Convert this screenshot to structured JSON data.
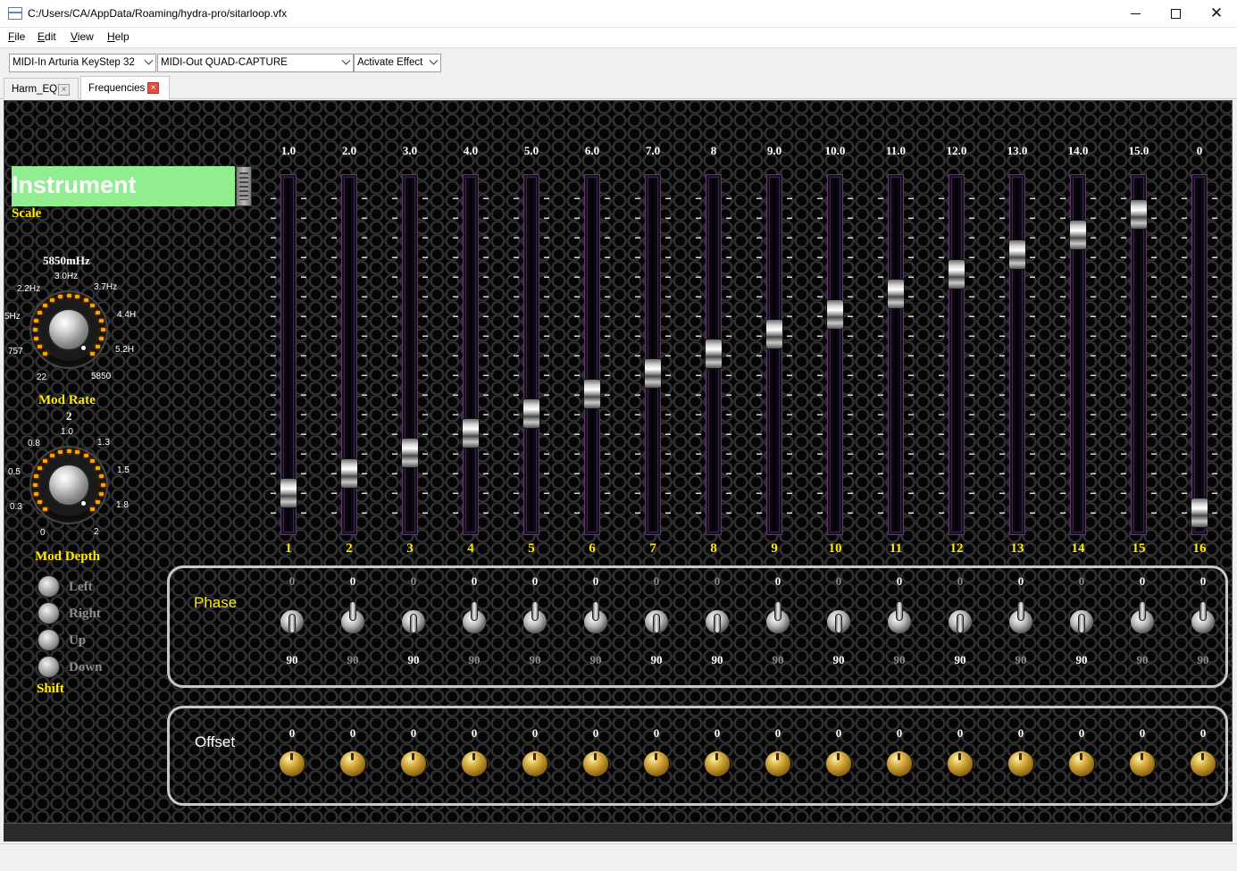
{
  "window": {
    "title": "C:/Users/CA/AppData/Roaming/hydra-pro/sitarloop.vfx",
    "minimize_glyph": "",
    "close_glyph": "✕"
  },
  "menu": [
    "File",
    "Edit",
    "View",
    "Help"
  ],
  "toolbar": {
    "midi_in": "MIDI-In Arturia KeyStep 32",
    "midi_out": "MIDI-Out QUAD-CAPTURE",
    "activate": "Activate Effect"
  },
  "tabs": [
    {
      "label": "Harm_EQ",
      "active": false
    },
    {
      "label": "Frequencies",
      "active": true
    }
  ],
  "left_panel": {
    "instrument": "Instrument",
    "scale_label": "Scale",
    "mod_rate": {
      "value": "5850mHz",
      "label": "Mod Rate",
      "ticks": [
        "2.2Hz",
        "3.0Hz",
        "3.7Hz",
        "5Hz",
        "4.4H",
        "757",
        "5.2H",
        "22",
        "5850"
      ]
    },
    "mod_depth": {
      "value": "2",
      "label": "Mod Depth",
      "ticks": [
        "0.8",
        "1.0",
        "1.3",
        "0.5",
        "1.5",
        "0.3",
        "1.8",
        "0",
        "2"
      ]
    },
    "shift": {
      "label": "Shift",
      "options": [
        "Left",
        "Right",
        "Up",
        "Down"
      ]
    }
  },
  "sliders": {
    "freq_labels": [
      "1.0",
      "2.0",
      "3.0",
      "4.0",
      "5.0",
      "6.0",
      "7.0",
      "8",
      "9.0",
      "10.0",
      "11.0",
      "12.0",
      "13.0",
      "14.0",
      "15.0",
      "0"
    ],
    "index_labels": [
      "1",
      "2",
      "3",
      "4",
      "5",
      "6",
      "7",
      "8",
      "9",
      "10",
      "11",
      "12",
      "13",
      "14",
      "15",
      "16"
    ],
    "positions": [
      0.0625,
      0.125,
      0.1875,
      0.25,
      0.3125,
      0.375,
      0.4375,
      0.5,
      0.5625,
      0.625,
      0.6875,
      0.75,
      0.8125,
      0.875,
      0.9375,
      0.0
    ]
  },
  "phase": {
    "title": "Phase",
    "top_values": [
      "0",
      "0",
      "0",
      "0",
      "0",
      "0",
      "0",
      "0",
      "0",
      "0",
      "0",
      "0",
      "0",
      "0",
      "0",
      "0"
    ],
    "bottom_values": [
      "90",
      "90",
      "90",
      "90",
      "90",
      "90",
      "90",
      "90",
      "90",
      "90",
      "90",
      "90",
      "90",
      "90",
      "90",
      "90"
    ],
    "is_90": [
      true,
      false,
      true,
      false,
      false,
      false,
      true,
      true,
      false,
      true,
      false,
      true,
      false,
      true,
      false,
      false
    ]
  },
  "offset": {
    "title": "Offset",
    "values": [
      "0",
      "0",
      "0",
      "0",
      "0",
      "0",
      "0",
      "0",
      "0",
      "0",
      "0",
      "0",
      "0",
      "0",
      "0",
      "0"
    ]
  },
  "colors": {
    "label_yellow": "#ffea00",
    "instrument_bg": "#90ee90",
    "led_orange": "#ffa200",
    "group_border": "#c8c8c8"
  }
}
